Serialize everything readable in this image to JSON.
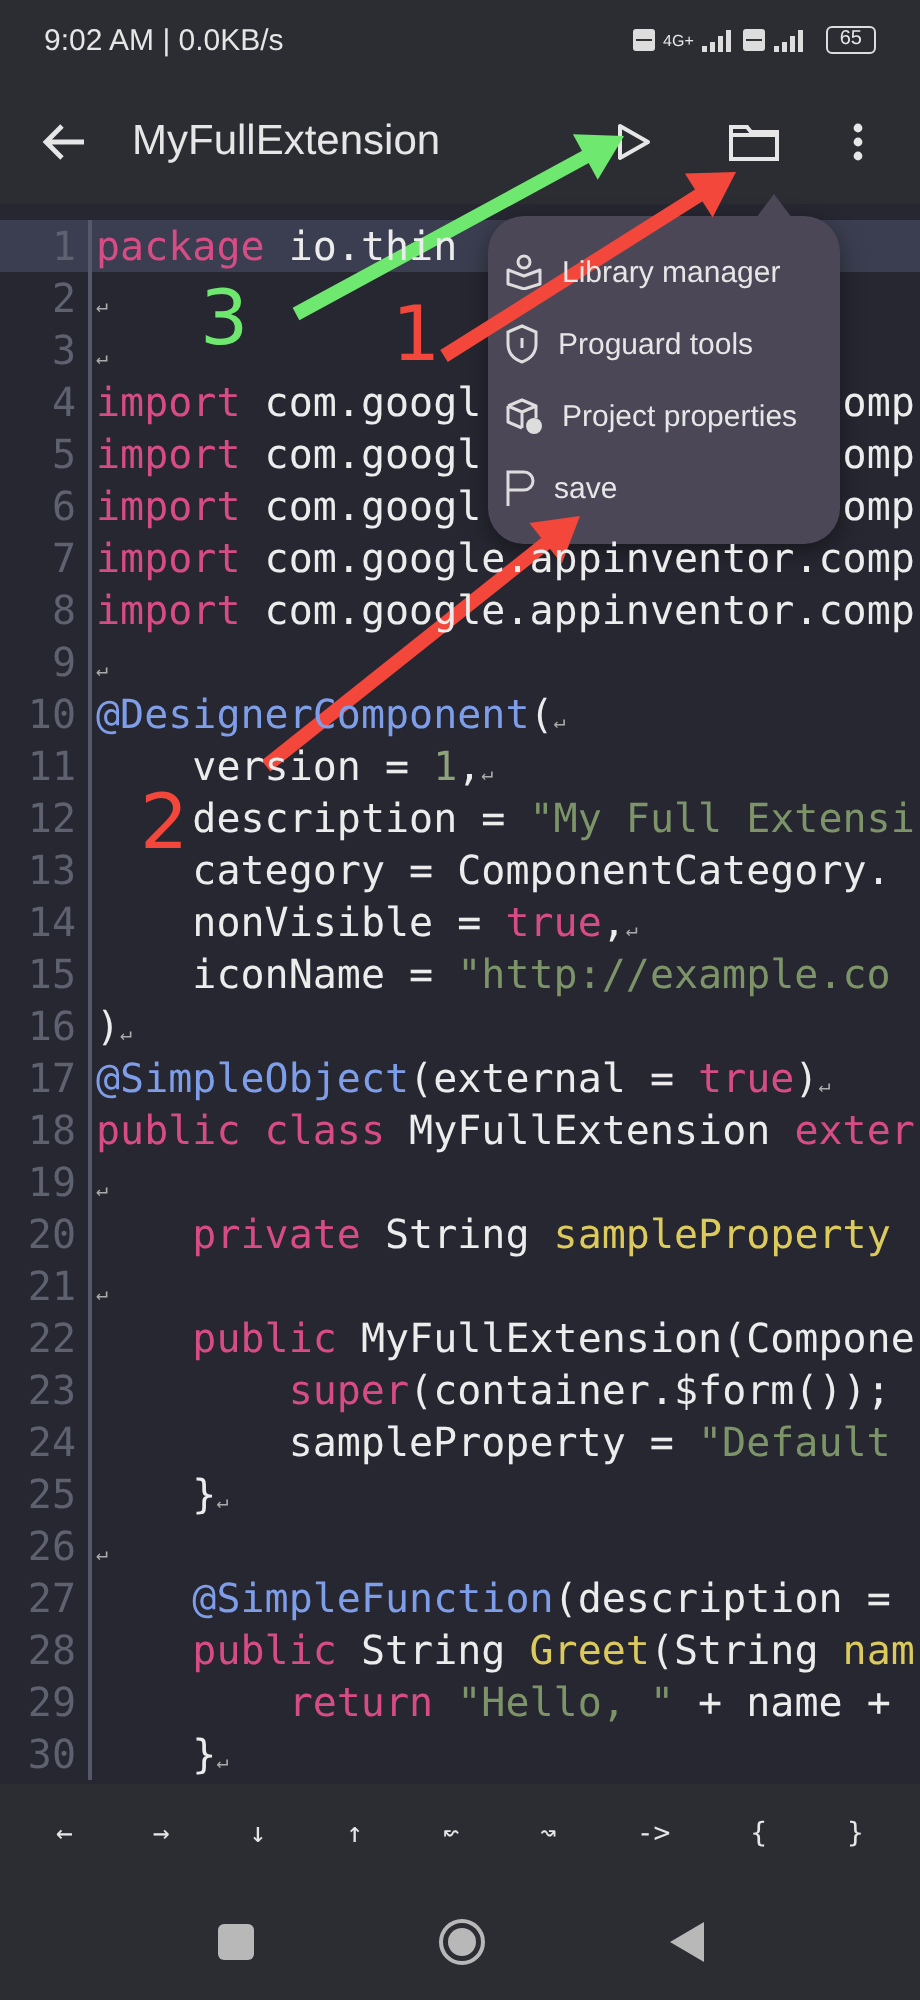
{
  "status_bar": {
    "time": "9:02 AM | 0.0KB/s",
    "network": "4G+",
    "battery": "65"
  },
  "toolbar": {
    "title": "MyFullExtension"
  },
  "menu": {
    "items": [
      {
        "label": "Library manager",
        "kind": "library"
      },
      {
        "label": "Proguard tools",
        "kind": "shield"
      },
      {
        "label": "Project properties",
        "kind": "properties"
      },
      {
        "label": "save",
        "kind": "flag"
      }
    ]
  },
  "editor": {
    "lines": [
      {
        "number": "1",
        "current": true,
        "tokens": [
          {
            "kind": "kw",
            "text": "package"
          },
          {
            "kind": "plain",
            "text": " io.thin"
          }
        ]
      },
      {
        "number": "2",
        "current": false,
        "tokens": [
          {
            "kind": "eol",
            "text": "↵"
          }
        ]
      },
      {
        "number": "3",
        "current": false,
        "tokens": [
          {
            "kind": "eol",
            "text": "↵"
          }
        ]
      },
      {
        "number": "4",
        "current": false,
        "tokens": [
          {
            "kind": "kw",
            "text": "import"
          },
          {
            "kind": "plain",
            "text": " com.googl"
          },
          {
            "kind": "gap"
          },
          {
            "kind": "plain",
            "text": "omp"
          }
        ]
      },
      {
        "number": "5",
        "current": false,
        "tokens": [
          {
            "kind": "kw",
            "text": "import"
          },
          {
            "kind": "plain",
            "text": " com.googl"
          },
          {
            "kind": "gap"
          },
          {
            "kind": "plain",
            "text": "omp"
          }
        ]
      },
      {
        "number": "6",
        "current": false,
        "tokens": [
          {
            "kind": "kw",
            "text": "import"
          },
          {
            "kind": "plain",
            "text": " com.googl"
          },
          {
            "kind": "gap"
          },
          {
            "kind": "plain",
            "text": "omp"
          }
        ]
      },
      {
        "number": "7",
        "current": false,
        "tokens": [
          {
            "kind": "kw",
            "text": "import"
          },
          {
            "kind": "plain",
            "text": " com.google.appinventor.comp"
          }
        ]
      },
      {
        "number": "8",
        "current": false,
        "tokens": [
          {
            "kind": "kw",
            "text": "import"
          },
          {
            "kind": "plain",
            "text": " com.google.appinventor.comp"
          }
        ]
      },
      {
        "number": "9",
        "current": false,
        "tokens": [
          {
            "kind": "eol",
            "text": "↵"
          }
        ]
      },
      {
        "number": "10",
        "current": false,
        "tokens": [
          {
            "kind": "ann",
            "text": "@DesignerComponent"
          },
          {
            "kind": "plain",
            "text": "("
          },
          {
            "kind": "eol",
            "text": "↵"
          }
        ]
      },
      {
        "number": "11",
        "current": false,
        "tokens": [
          {
            "kind": "indent"
          },
          {
            "kind": "plain",
            "text": "version = "
          },
          {
            "kind": "num",
            "text": "1"
          },
          {
            "kind": "plain",
            "text": ","
          },
          {
            "kind": "eol",
            "text": "↵"
          }
        ]
      },
      {
        "number": "12",
        "current": false,
        "tokens": [
          {
            "kind": "indent"
          },
          {
            "kind": "plain",
            "text": "description = "
          },
          {
            "kind": "str",
            "text": "\"My Full Extensi"
          }
        ]
      },
      {
        "number": "13",
        "current": false,
        "tokens": [
          {
            "kind": "indent"
          },
          {
            "kind": "plain",
            "text": "category = ComponentCategory."
          }
        ]
      },
      {
        "number": "14",
        "current": false,
        "tokens": [
          {
            "kind": "indent"
          },
          {
            "kind": "plain",
            "text": "nonVisible = "
          },
          {
            "kind": "kw",
            "text": "true"
          },
          {
            "kind": "plain",
            "text": ","
          },
          {
            "kind": "eol",
            "text": "↵"
          }
        ]
      },
      {
        "number": "15",
        "current": false,
        "tokens": [
          {
            "kind": "indent"
          },
          {
            "kind": "plain",
            "text": "iconName = "
          },
          {
            "kind": "str",
            "text": "\"http://example.co"
          }
        ]
      },
      {
        "number": "16",
        "current": false,
        "tokens": [
          {
            "kind": "plain",
            "text": ")"
          },
          {
            "kind": "eol",
            "text": "↵"
          }
        ]
      },
      {
        "number": "17",
        "current": false,
        "tokens": [
          {
            "kind": "ann",
            "text": "@SimpleObject"
          },
          {
            "kind": "plain",
            "text": "(external = "
          },
          {
            "kind": "kw",
            "text": "true"
          },
          {
            "kind": "plain",
            "text": ")"
          },
          {
            "kind": "eol",
            "text": "↵"
          }
        ]
      },
      {
        "number": "18",
        "current": false,
        "tokens": [
          {
            "kind": "kw",
            "text": "public class"
          },
          {
            "kind": "plain",
            "text": " MyFullExtension "
          },
          {
            "kind": "kw",
            "text": "exter"
          }
        ]
      },
      {
        "number": "19",
        "current": false,
        "tokens": [
          {
            "kind": "eol",
            "text": "↵"
          }
        ]
      },
      {
        "number": "20",
        "current": false,
        "tokens": [
          {
            "kind": "indent"
          },
          {
            "kind": "kw",
            "text": "private"
          },
          {
            "kind": "plain",
            "text": " String "
          },
          {
            "kind": "fn",
            "text": "sampleProperty"
          }
        ]
      },
      {
        "number": "21",
        "current": false,
        "tokens": [
          {
            "kind": "eol",
            "text": "↵"
          }
        ]
      },
      {
        "number": "22",
        "current": false,
        "tokens": [
          {
            "kind": "indent"
          },
          {
            "kind": "kw",
            "text": "public"
          },
          {
            "kind": "plain",
            "text": " MyFullExtension(Compone"
          }
        ]
      },
      {
        "number": "23",
        "current": false,
        "tokens": [
          {
            "kind": "indent"
          },
          {
            "kind": "indent"
          },
          {
            "kind": "kw",
            "text": "super"
          },
          {
            "kind": "plain",
            "text": "(container.$form());"
          }
        ]
      },
      {
        "number": "24",
        "current": false,
        "tokens": [
          {
            "kind": "indent"
          },
          {
            "kind": "indent"
          },
          {
            "kind": "plain",
            "text": "sampleProperty = "
          },
          {
            "kind": "str",
            "text": "\"Default"
          }
        ]
      },
      {
        "number": "25",
        "current": false,
        "tokens": [
          {
            "kind": "indent"
          },
          {
            "kind": "plain",
            "text": "}"
          },
          {
            "kind": "eol",
            "text": "↵"
          }
        ]
      },
      {
        "number": "26",
        "current": false,
        "tokens": [
          {
            "kind": "eol",
            "text": "↵"
          }
        ]
      },
      {
        "number": "27",
        "current": false,
        "tokens": [
          {
            "kind": "indent"
          },
          {
            "kind": "ann",
            "text": "@SimpleFunction"
          },
          {
            "kind": "plain",
            "text": "(description ="
          }
        ]
      },
      {
        "number": "28",
        "current": false,
        "tokens": [
          {
            "kind": "indent"
          },
          {
            "kind": "kw",
            "text": "public"
          },
          {
            "kind": "plain",
            "text": " String "
          },
          {
            "kind": "fn",
            "text": "Greet"
          },
          {
            "kind": "plain",
            "text": "(String "
          },
          {
            "kind": "fn",
            "text": "nam"
          }
        ]
      },
      {
        "number": "29",
        "current": false,
        "tokens": [
          {
            "kind": "indent"
          },
          {
            "kind": "indent"
          },
          {
            "kind": "kw",
            "text": "return "
          },
          {
            "kind": "str",
            "text": "\"Hello, \""
          },
          {
            "kind": "plain",
            "text": " + name +"
          }
        ]
      },
      {
        "number": "30",
        "current": false,
        "tokens": [
          {
            "kind": "indent"
          },
          {
            "kind": "plain",
            "text": "}"
          },
          {
            "kind": "eol",
            "text": "↵"
          }
        ]
      }
    ]
  },
  "symbol_keys": [
    "←",
    "→",
    "↓",
    "↑",
    "↜",
    "↝",
    "->",
    "{",
    "}"
  ],
  "annotations": [
    {
      "label": "3",
      "color": "#6ee86e"
    },
    {
      "label": "1",
      "color": "#f2473a"
    },
    {
      "label": "2",
      "color": "#f2473a"
    }
  ]
}
